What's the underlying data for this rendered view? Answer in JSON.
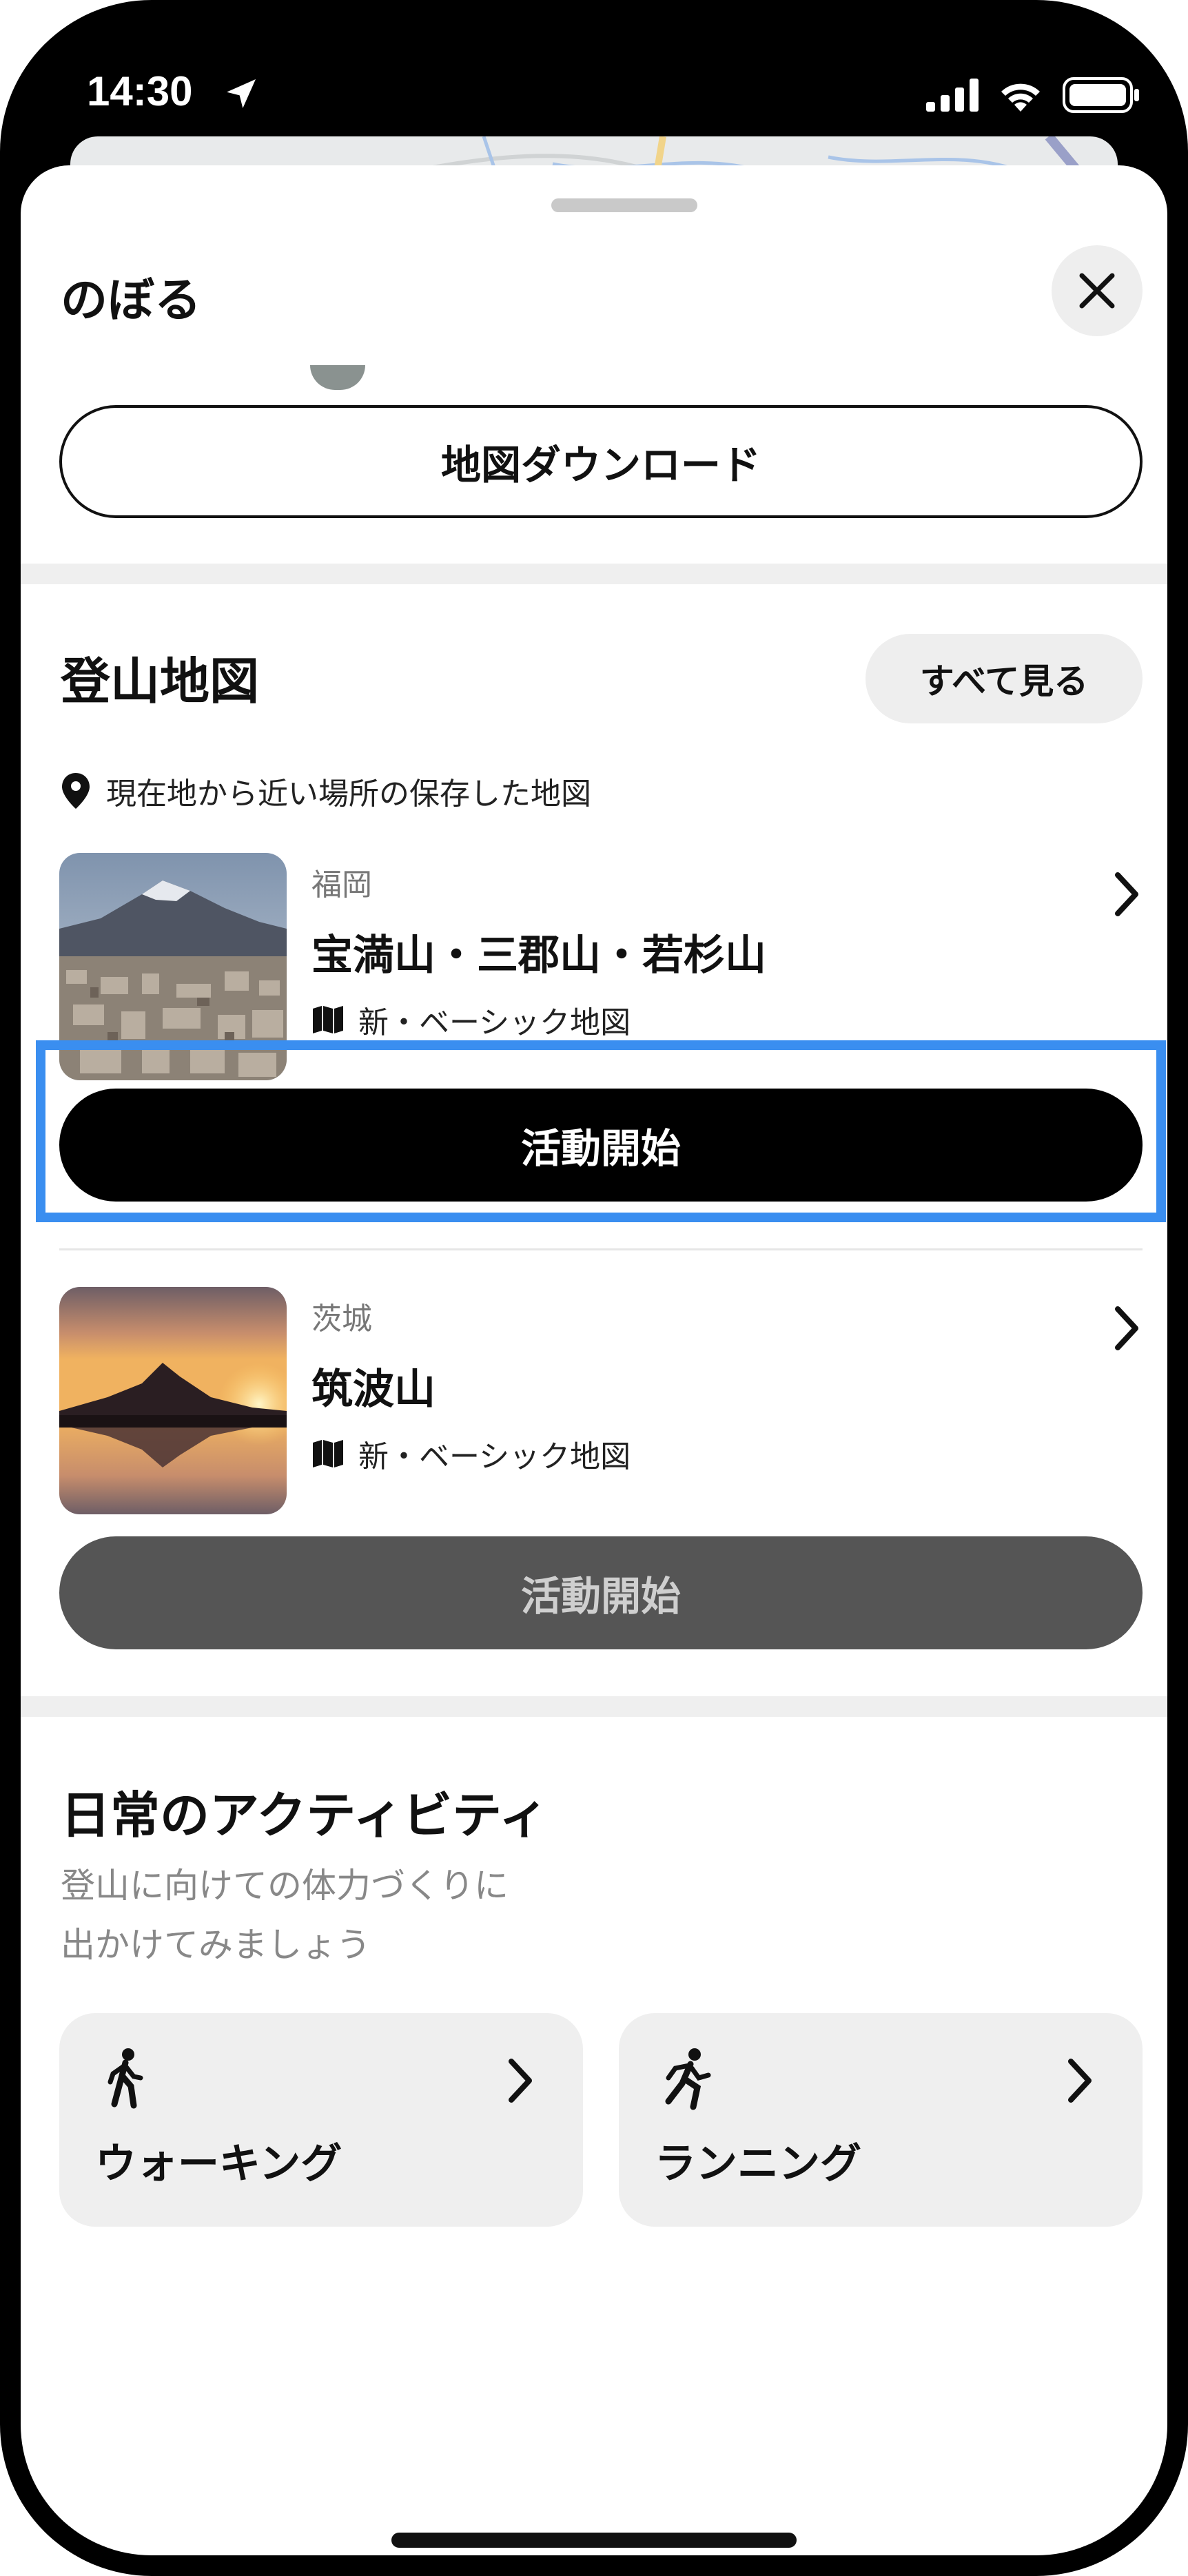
{
  "status_bar": {
    "time": "14:30"
  },
  "sheet": {
    "title": "のぼる",
    "download_label": "地図ダウンロード"
  },
  "mountain_maps": {
    "title": "登山地図",
    "see_all_label": "すべて見る",
    "subtitle": "現在地から近い場所の保存した地図",
    "items": [
      {
        "region": "福岡",
        "name": "宝満山・三郡山・若杉山",
        "map_type": "新・ベーシック地図",
        "start_label": "活動開始"
      },
      {
        "region": "茨城",
        "name": "筑波山",
        "map_type": "新・ベーシック地図",
        "start_label": "活動開始"
      }
    ]
  },
  "daily_activity": {
    "title": "日常のアクティビティ",
    "subtitle_line1": "登山に向けての体力づくりに",
    "subtitle_line2": "出かけてみましょう",
    "cards": [
      {
        "label": "ウォーキング",
        "icon": "walking-icon"
      },
      {
        "label": "ランニング",
        "icon": "running-icon"
      }
    ]
  },
  "colors": {
    "primary_button": "#000000",
    "disabled_button": "#555555",
    "highlight_frame": "#3a8ef0",
    "card_background": "#efefef"
  }
}
